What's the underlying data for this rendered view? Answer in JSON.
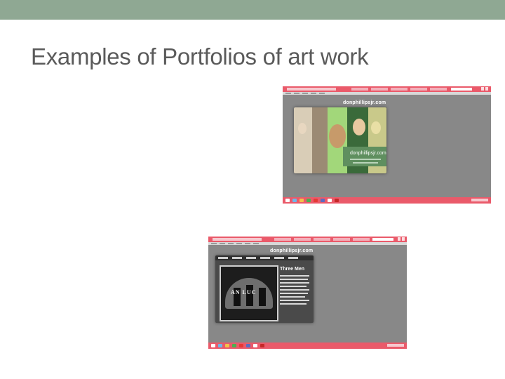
{
  "slide": {
    "title": "Examples of Portfolios of art work"
  },
  "screenshots": [
    {
      "site_name": "donphillipsjr.com",
      "card_label": "donphillipsjr.com"
    },
    {
      "site_name": "donphillipsjr.com",
      "art_title": "Three Men",
      "stage_text": "AN  LUC"
    }
  ],
  "colors": {
    "header_bar": "#8fa893",
    "title_text": "#5a5a5a",
    "browser_chrome": "#ea5a6a",
    "page_background": "#888888"
  }
}
